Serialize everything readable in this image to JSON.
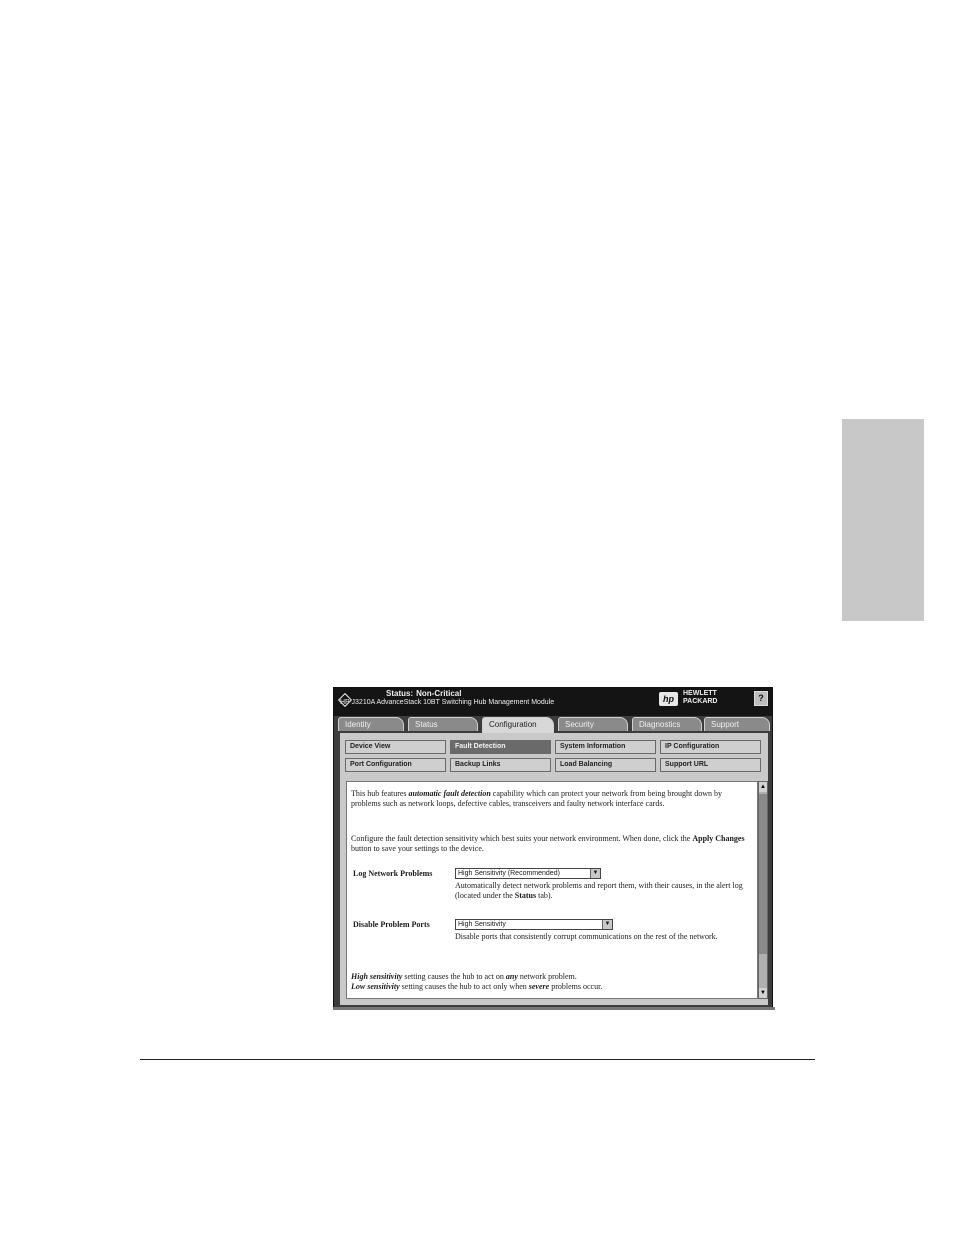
{
  "header": {
    "status_label": "Status:",
    "status_value": "Non-Critical",
    "product": "HP J3210A AdvanceStack 10BT Switching Hub Management Module",
    "logo_text": "hp",
    "brand_line1": "HEWLETT",
    "brand_line2": "PACKARD",
    "help_label": "?"
  },
  "tabs": [
    {
      "label": "Identity"
    },
    {
      "label": "Status"
    },
    {
      "label": "Configuration",
      "active": true
    },
    {
      "label": "Security"
    },
    {
      "label": "Diagnostics"
    },
    {
      "label": "Support"
    }
  ],
  "subnav": {
    "row1": [
      "Device View",
      "Fault Detection",
      "System Information",
      "IP Configuration"
    ],
    "row2": [
      "Port Configuration",
      "Backup Links",
      "Load Balancing",
      "Support URL"
    ],
    "active": "Fault Detection"
  },
  "content": {
    "intro_pre": "This hub features ",
    "intro_em": "automatic fault detection",
    "intro_post": " capability which can protect your network from being brought down by problems such as network loops, defective cables, transceivers and faulty network interface cards.",
    "config_pre": "Configure the fault detection sensitivity which best suits your network environment. When done, click the ",
    "config_bold": "Apply Changes",
    "config_post": " button to save your settings to the device.",
    "log_label": "Log Network Problems",
    "log_value": "High Sensitivity (Recommended)",
    "log_desc_pre": "Automatically detect network problems and report them, with their causes, in the alert log (located under the ",
    "log_desc_bold": "Status",
    "log_desc_post": " tab).",
    "disable_label": "Disable Problem Ports",
    "disable_value": "High Sensitivity",
    "disable_desc": "Disable ports that consistently corrupt communications on the rest of the network.",
    "high_em": "High sensitivity",
    "high_mid": " setting causes the hub to act on ",
    "high_em2": "any",
    "high_post": " network problem.",
    "low_em": "Low sensitivity",
    "low_mid": " setting causes the hub to act only when ",
    "low_em2": "severe",
    "low_post": " problems occur."
  },
  "icons": {
    "status": "diamond-icon",
    "dropdown": "chevron-down-icon",
    "scroll_up": "arrow-up-icon",
    "scroll_down": "arrow-down-icon"
  }
}
